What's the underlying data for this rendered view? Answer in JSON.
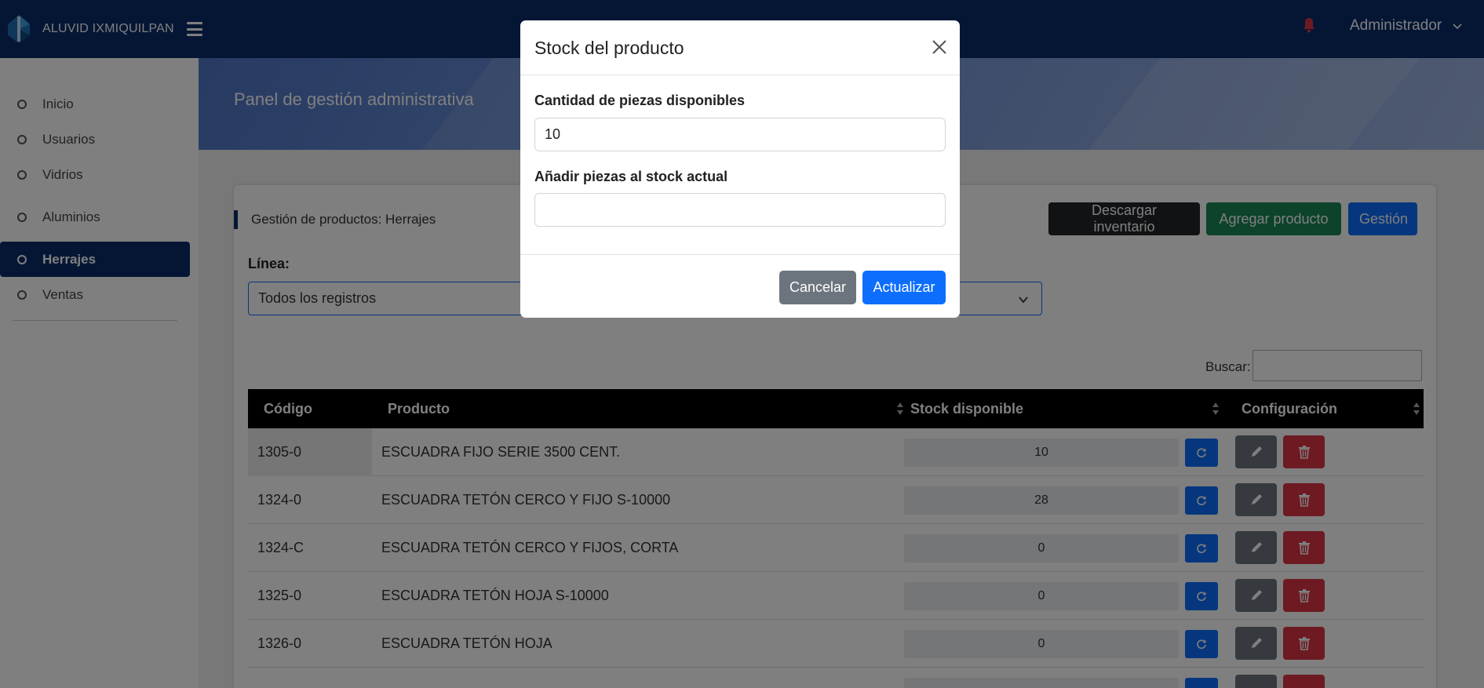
{
  "brand": {
    "name": "ALUVID IXMIQUILPAN"
  },
  "user": {
    "name": "Administrador"
  },
  "sidebar": {
    "items": [
      {
        "label": "Inicio",
        "active": false
      },
      {
        "label": "Usuarios",
        "active": false
      },
      {
        "label": "Vidrios",
        "active": false
      },
      {
        "label": "Aluminios",
        "active": false
      },
      {
        "label": "Herrajes",
        "active": true
      },
      {
        "label": "Ventas",
        "active": false
      }
    ]
  },
  "hero": {
    "title": "Panel de gestión administrativa"
  },
  "card": {
    "title": "Gestión de productos: Herrajes",
    "buttons": {
      "download": "Descargar inventario",
      "add": "Agregar producto",
      "manage": "Gestión"
    },
    "line_label": "Línea:",
    "line_value": "Todos los registros",
    "search_label": "Buscar:"
  },
  "table": {
    "headers": [
      "Código",
      "Producto",
      "Stock disponible",
      "Configuración"
    ],
    "rows": [
      {
        "code": "1305-0",
        "product": "ESCUADRA FIJO SERIE 3500 CENT.",
        "stock": "10"
      },
      {
        "code": "1324-0",
        "product": "ESCUADRA TETÓN CERCO Y FIJO S-10000",
        "stock": "28"
      },
      {
        "code": "1324-C",
        "product": "ESCUADRA TETÓN CERCO Y FIJOS, CORTA",
        "stock": "0"
      },
      {
        "code": "1325-0",
        "product": "ESCUADRA TETÓN HOJA S-10000",
        "stock": "0"
      },
      {
        "code": "1326-0",
        "product": "ESCUADRA TETÓN HOJA",
        "stock": "0"
      }
    ]
  },
  "modal": {
    "title": "Stock del producto",
    "available_label": "Cantidad de piezas disponibles",
    "available_value": "10",
    "add_label": "Añadir piezas al stock actual",
    "add_value": "",
    "cancel": "Cancelar",
    "update": "Actualizar"
  },
  "colors": {
    "navbar": "#0a2d6b",
    "primary": "#0d6efd",
    "success": "#198754",
    "danger": "#dc3545",
    "secondary": "#6c757d",
    "dark": "#212529",
    "notification": "#dc3545"
  }
}
